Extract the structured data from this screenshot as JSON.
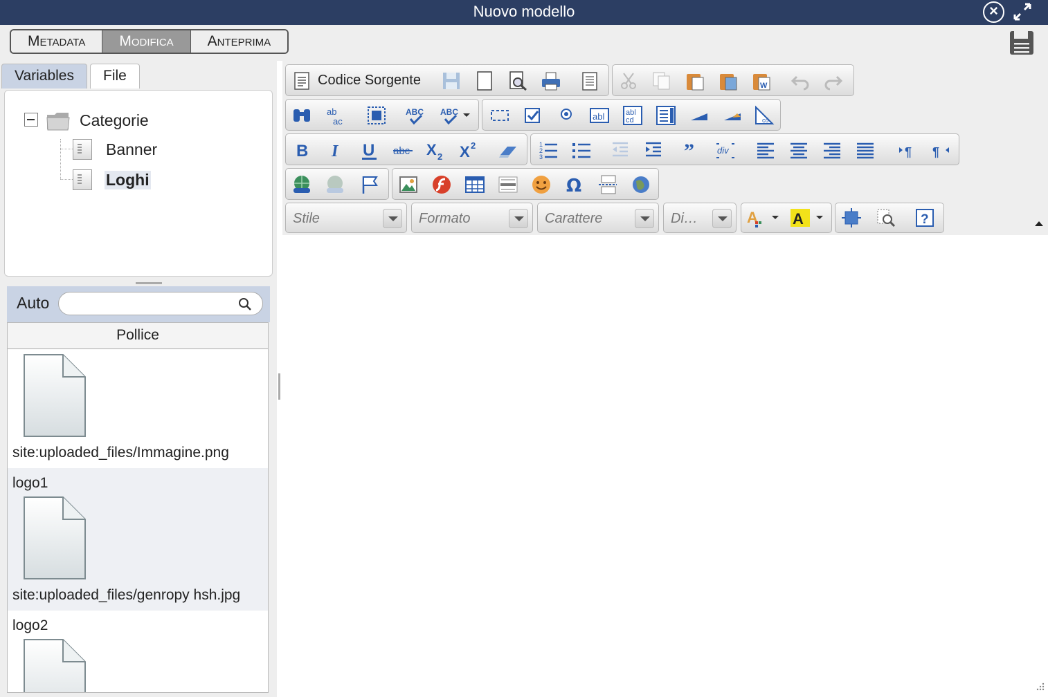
{
  "window": {
    "title": "Nuovo modello"
  },
  "mode_tabs": [
    {
      "label": "Metadata",
      "active": false
    },
    {
      "label": "Modifica",
      "active": true
    },
    {
      "label": "Anteprima",
      "active": false
    }
  ],
  "left_tabs": [
    {
      "label": "Variables",
      "active": false
    },
    {
      "label": "File",
      "active": true
    }
  ],
  "tree": {
    "root": "Categorie",
    "children": [
      {
        "label": "Banner",
        "selected": false
      },
      {
        "label": "Loghi",
        "selected": true
      }
    ]
  },
  "search": {
    "label": "Auto",
    "placeholder": ""
  },
  "thumbs": {
    "header": "Pollice",
    "items": [
      {
        "name": "",
        "path": "site:uploaded_files/Immagine.png"
      },
      {
        "name": "logo1",
        "path": "site:uploaded_files/genropy hsh.jpg"
      },
      {
        "name": "logo2",
        "path": ""
      }
    ]
  },
  "editor": {
    "source_label": "Codice Sorgente",
    "combos": {
      "style": "Stile",
      "format": "Formato",
      "font": "Carattere",
      "size": "Di…"
    }
  },
  "colors": {
    "titlebar": "#2c3e63",
    "tab_inactive": "#c9d3e4",
    "toolbar_icon": "#2a5db0"
  }
}
